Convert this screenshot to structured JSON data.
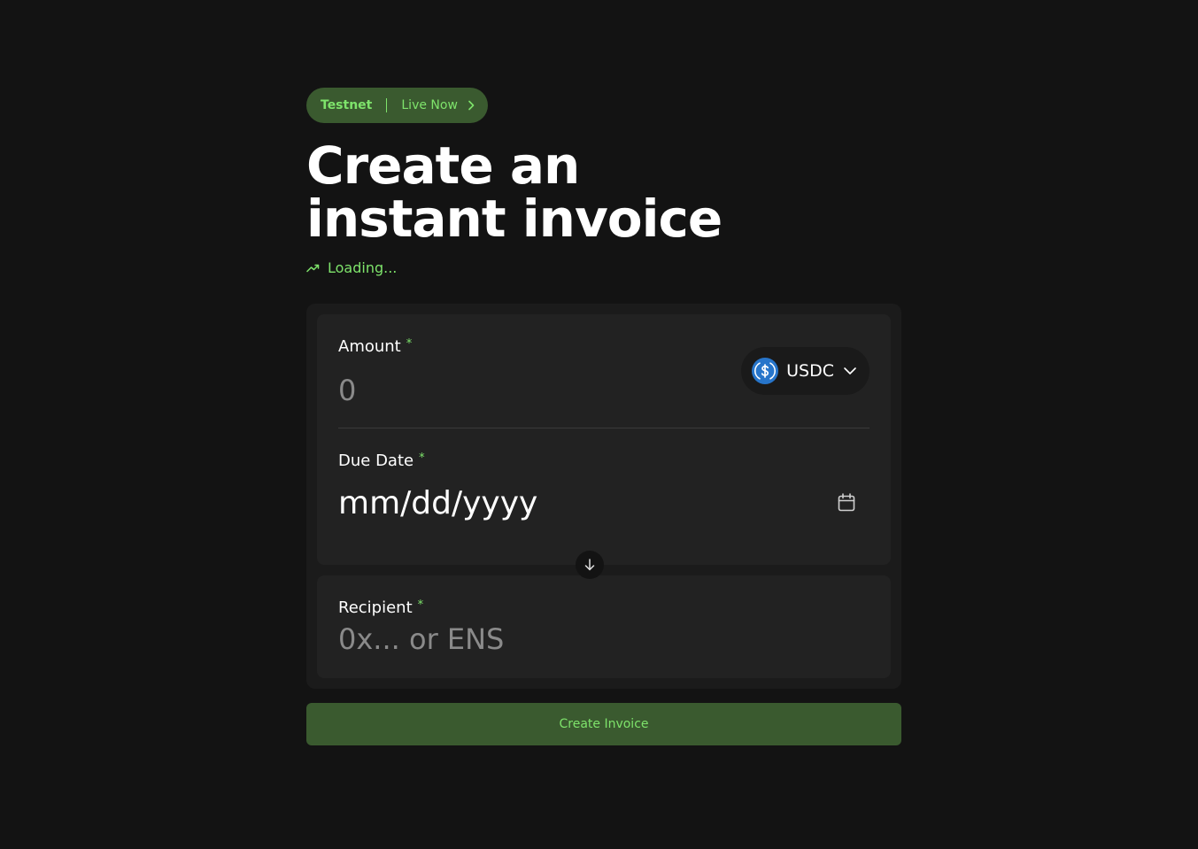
{
  "badge": {
    "network": "Testnet",
    "link": "Live Now",
    "chevron_icon": "chevron-right-icon"
  },
  "hero": {
    "title_line1": "Create an",
    "title_line2": "instant invoice",
    "status": "Loading...",
    "status_icon": "trending-up-icon"
  },
  "form": {
    "amount": {
      "label": "Amount",
      "required_mark": "*",
      "placeholder": "0",
      "token": {
        "symbol": "USDC",
        "icon": "usdc-coin-icon",
        "dropdown_icon": "chevron-down-icon"
      }
    },
    "due_date": {
      "label": "Due Date",
      "required_mark": "*",
      "placeholder": "mm/dd/yyyy",
      "icon": "calendar-icon"
    },
    "swap_icon": "arrow-down-icon",
    "recipient": {
      "label": "Recipient",
      "required_mark": "*",
      "placeholder": "0x... or ENS"
    },
    "submit_label": "Create Invoice"
  },
  "colors": {
    "background": "#131313",
    "card": "#1b1b1b",
    "section": "#222222",
    "accent": "#7ee36b",
    "accent_bg": "#3a5a2f",
    "usdc_blue": "#2775ca"
  }
}
